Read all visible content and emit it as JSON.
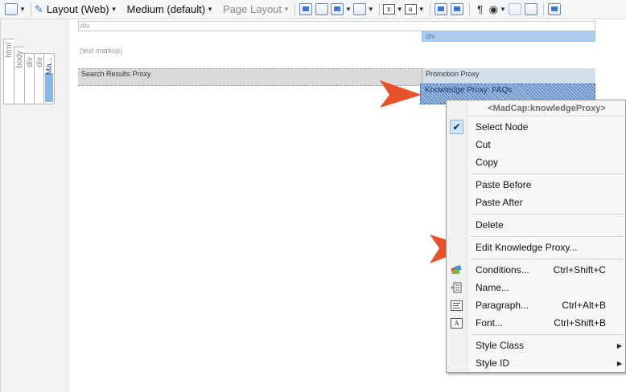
{
  "toolbar": {
    "layout_label": "Layout (Web)",
    "medium_label": "Medium (default)",
    "page_layout_label": "Page Layout"
  },
  "structure_bar": {
    "columns": [
      "html",
      "body",
      "div",
      "div",
      "Ma..."
    ]
  },
  "editor": {
    "div_label_1": "div",
    "div_label_2": "div",
    "text_markup": "(text markup)",
    "search_results_proxy": "Search Results Proxy",
    "promotion_proxy": "Promotion Proxy",
    "knowledge_proxy": "Knowledge Proxy: FAQs"
  },
  "context_menu": {
    "header": "<MadCap:knowledgeProxy>",
    "select_node": "Select Node",
    "cut": "Cut",
    "copy": "Copy",
    "paste_before": "Paste Before",
    "paste_after": "Paste After",
    "delete": "Delete",
    "edit_knowledge_proxy": "Edit Knowledge Proxy...",
    "conditions": "Conditions...",
    "conditions_shortcut": "Ctrl+Shift+C",
    "name": "Name...",
    "paragraph": "Paragraph...",
    "paragraph_shortcut": "Ctrl+Alt+B",
    "font": "Font...",
    "font_shortcut": "Ctrl+Shift+B",
    "style_class": "Style Class",
    "style_id": "Style ID"
  },
  "colors": {
    "arrow": "#e8522a",
    "selection": "#8bb7e7"
  }
}
